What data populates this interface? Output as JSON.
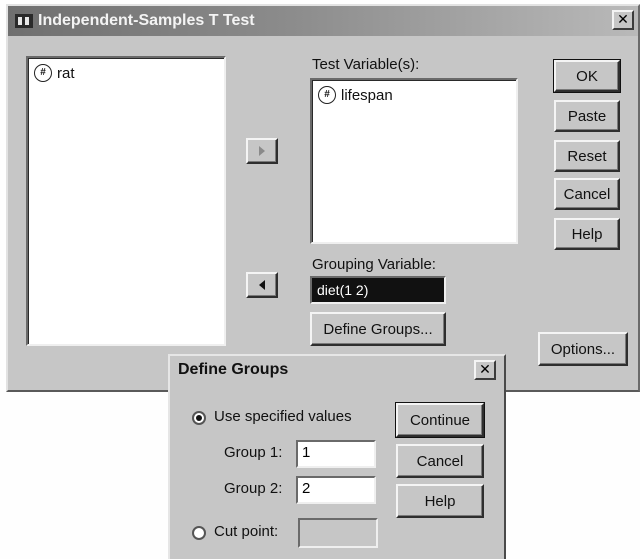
{
  "main_dialog": {
    "title": "Independent-Samples T Test",
    "close_glyph": "✕",
    "source_variables": [
      {
        "label": "rat",
        "icon": "scale-variable-icon"
      }
    ],
    "test_variables_label": "Test Variable(s):",
    "test_variables": [
      {
        "label": "lifespan",
        "icon": "scale-variable-icon"
      }
    ],
    "grouping_variable_label": "Grouping Variable:",
    "grouping_variable_value": "diet(1 2)",
    "define_groups_button": "Define Groups...",
    "buttons": {
      "ok": "OK",
      "paste": "Paste",
      "reset": "Reset",
      "cancel": "Cancel",
      "help": "Help",
      "options": "Options..."
    }
  },
  "define_groups_dialog": {
    "title": "Define Groups",
    "close_glyph": "✕",
    "use_specified_values_label": "Use specified values",
    "use_specified_values_selected": true,
    "group1_label": "Group 1:",
    "group1_value": "1",
    "group2_label": "Group 2:",
    "group2_value": "2",
    "cut_point_label": "Cut point:",
    "cut_point_value": "",
    "buttons": {
      "continue": "Continue",
      "cancel": "Cancel",
      "help": "Help"
    }
  }
}
